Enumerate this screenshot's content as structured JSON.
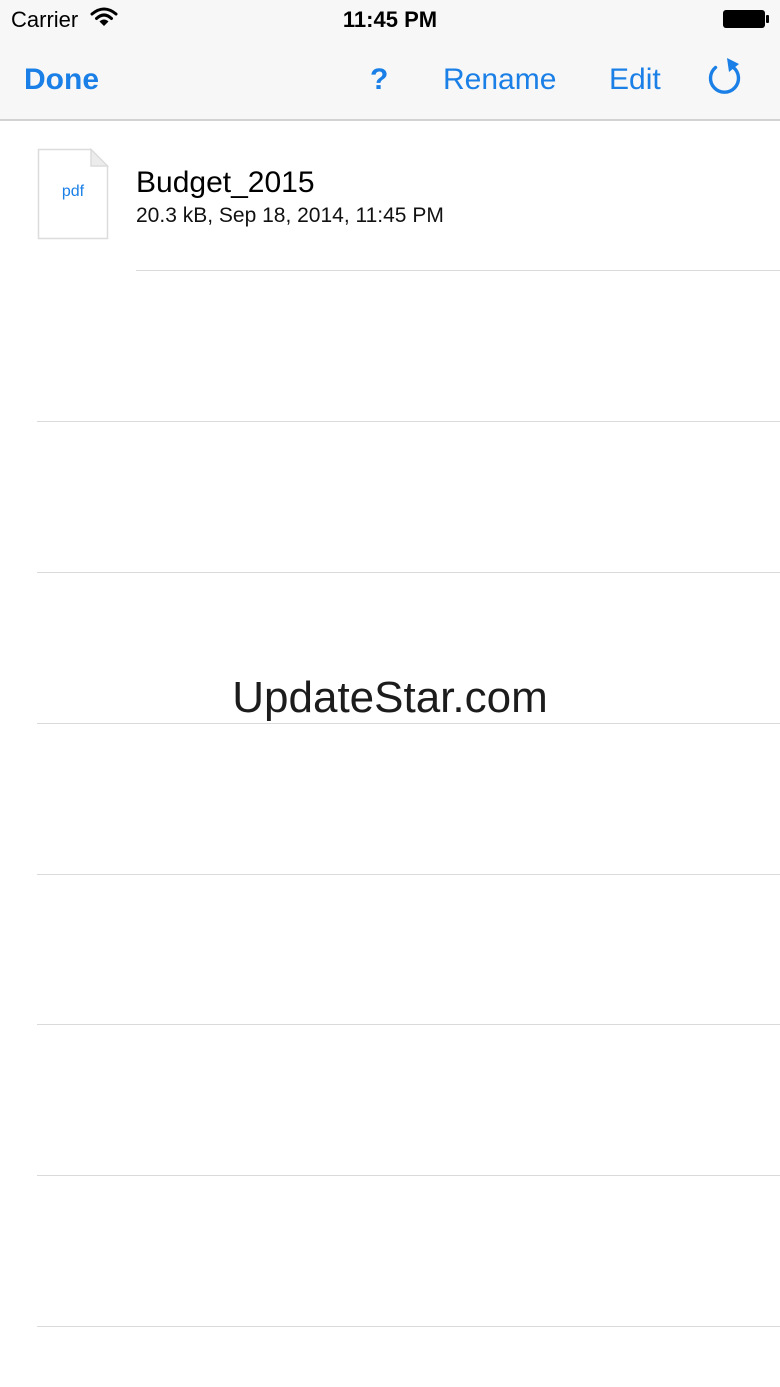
{
  "status_bar": {
    "carrier": "Carrier",
    "time": "11:45 PM",
    "wifi_icon": "wifi-icon",
    "battery_icon": "battery-full-icon"
  },
  "nav_bar": {
    "done_label": "Done",
    "help_label": "?",
    "rename_label": "Rename",
    "edit_label": "Edit",
    "refresh_icon": "refresh-icon"
  },
  "files": [
    {
      "icon_label": "pdf",
      "name": "Budget_2015",
      "details": "20.3 kB, Sep 18, 2014, 11:45 PM"
    }
  ],
  "watermark": "UpdateStar.com",
  "colors": {
    "accent": "#1a7fe6",
    "bar_background": "#f7f7f7",
    "separator": "#dadada"
  }
}
